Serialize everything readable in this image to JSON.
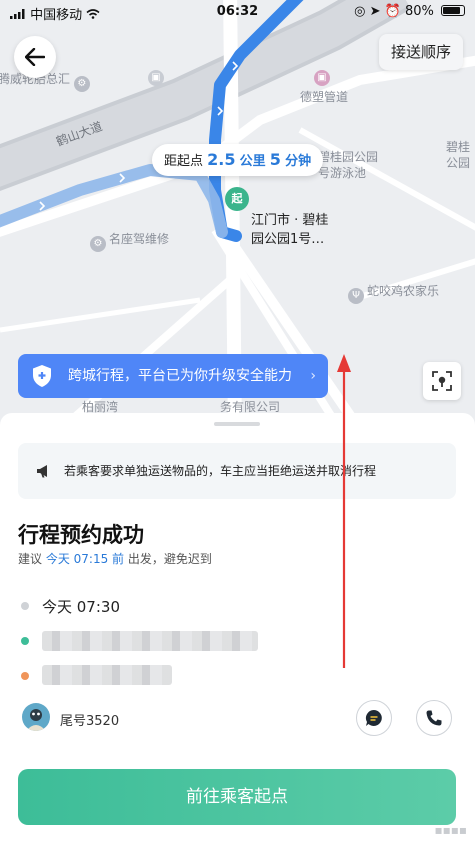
{
  "status_bar": {
    "carrier": "中国移动",
    "time": "06:32",
    "battery": "80%"
  },
  "map": {
    "pickup_order_label": "接送顺序",
    "distance_prefix": "距起点",
    "distance_value": "2.5",
    "distance_unit": "公里",
    "duration_value": "5",
    "duration_unit": "分钟",
    "start_pin_label": "起",
    "start_address_line1": "江门市 · 碧桂",
    "start_address_line2": "园公园1号…",
    "pois": [
      {
        "label": "腾威轮胎总汇"
      },
      {
        "label": "德塑管道"
      },
      {
        "label": "鹤山大道"
      },
      {
        "label": "碧桂园公园"
      },
      {
        "label": "号游泳池"
      },
      {
        "label": "碧桂"
      },
      {
        "label": "公园"
      },
      {
        "label": "名座驾维修"
      },
      {
        "label": "蛇咬鸡农家乐"
      },
      {
        "label": "柏丽湾"
      },
      {
        "label": "务有限公司"
      }
    ],
    "safety_banner": "跨城行程，平台已为你升级安全能力"
  },
  "sheet": {
    "notice": "若乘客要求单独运送物品的，车主应当拒绝运送并取消行程",
    "title": "行程预约成功",
    "hint_prefix": "建议",
    "hint_time": "今天 07:15 前",
    "hint_suffix": "出发，避免迟到",
    "depart_time": "今天 07:30",
    "passenger_tail": "尾号3520",
    "go_button": "前往乘客起点"
  },
  "colors": {
    "accent_green": "#3dbd98",
    "accent_blue": "#2a7ad8",
    "banner_blue": "#4f86f7",
    "route_blue": "#3a86e8",
    "annotation_red": "#e53935"
  }
}
